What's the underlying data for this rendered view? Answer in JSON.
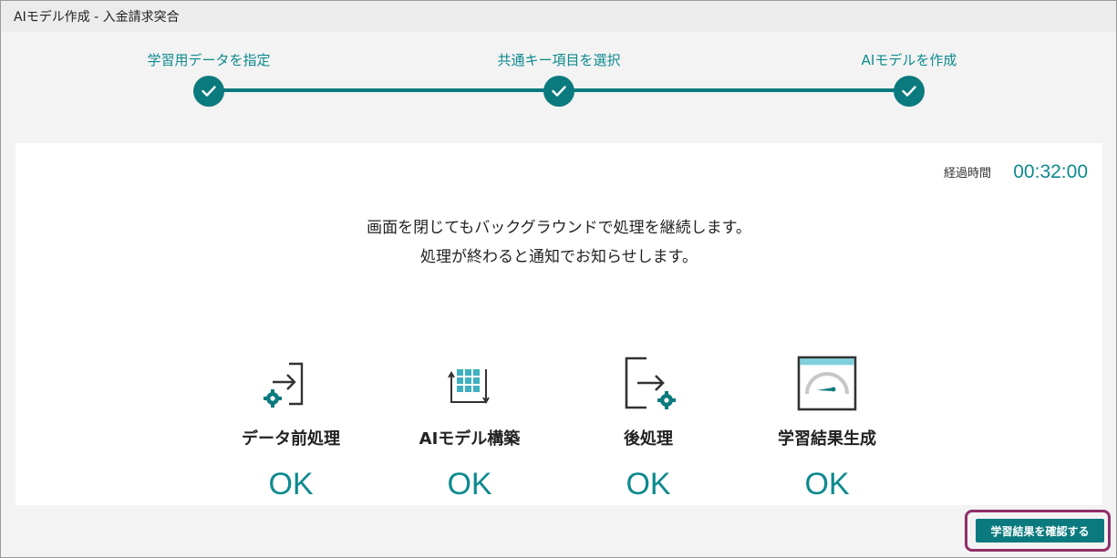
{
  "window": {
    "title": "AIモデル作成 - 入金請求突合"
  },
  "stepper": {
    "steps": [
      {
        "label": "学習用データを指定",
        "status": "completed",
        "icon": "check-icon"
      },
      {
        "label": "共通キー項目を選択",
        "status": "completed",
        "icon": "check-icon"
      },
      {
        "label": "AIモデルを作成",
        "status": "completed",
        "icon": "check-icon"
      }
    ]
  },
  "elapsed": {
    "label": "経過時間",
    "value": "00:32:00"
  },
  "messages": {
    "line1": "画面を閉じてもバックグラウンドで処理を継続します。",
    "line2": "処理が終わると通知でお知らせします。"
  },
  "tasks": [
    {
      "name": "データ前処理",
      "status": "OK",
      "icon": "import-gear-icon"
    },
    {
      "name": "AIモデル構築",
      "status": "OK",
      "icon": "grid-build-icon"
    },
    {
      "name": "後処理",
      "status": "OK",
      "icon": "export-gear-icon"
    },
    {
      "name": "学習結果生成",
      "status": "OK",
      "icon": "gauge-window-icon"
    }
  ],
  "footer": {
    "confirm_label": "学習結果を確認する"
  },
  "colors": {
    "accent": "#0b7a7e",
    "accent_text": "#0e8a8e",
    "highlight": "#8f2f6a",
    "icon_light": "#3fb0c0"
  }
}
